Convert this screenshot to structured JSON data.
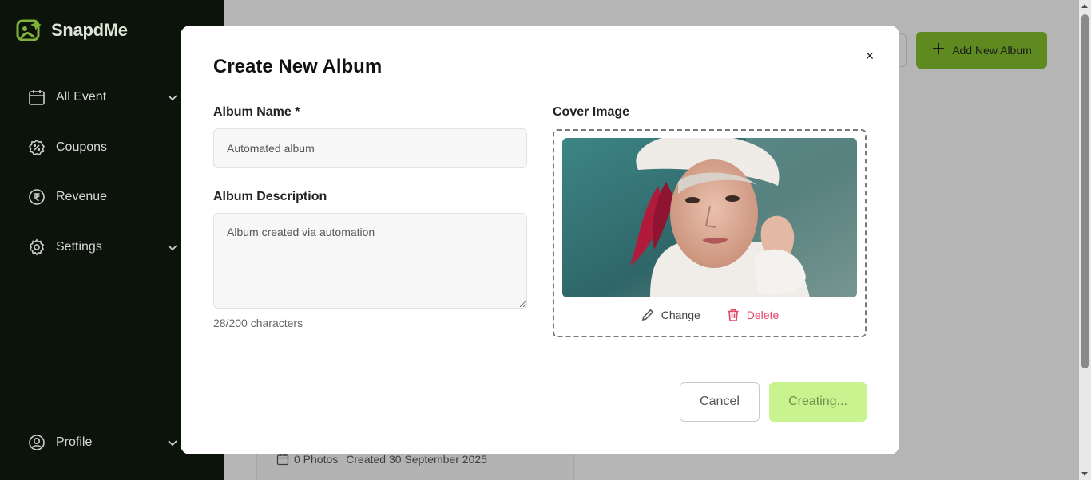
{
  "app": {
    "name": "SnapdMe"
  },
  "sidebar": {
    "items": [
      {
        "label": "All Event",
        "icon": "calendar-icon",
        "expandable": true
      },
      {
        "label": "Coupons",
        "icon": "coupon-icon",
        "expandable": false
      },
      {
        "label": "Revenue",
        "icon": "rupee-icon",
        "expandable": false
      },
      {
        "label": "Settings",
        "icon": "gear-icon",
        "expandable": true
      }
    ],
    "profile": {
      "label": "Profile",
      "icon": "user-circle-icon",
      "expandable": true
    }
  },
  "background": {
    "add_album_label": "Add New Album",
    "card": {
      "photos": "0 Photos",
      "created": "Created 30 September 2025"
    }
  },
  "modal": {
    "title": "Create New Album",
    "close_label": "×",
    "album_name": {
      "label": "Album Name *",
      "value": "Automated album"
    },
    "album_description": {
      "label": "Album Description",
      "value": "Album created via automation",
      "char_count": "28/200 characters"
    },
    "cover_image": {
      "label": "Cover Image",
      "change_label": "Change",
      "delete_label": "Delete"
    },
    "cancel_label": "Cancel",
    "submit_label": "Creating..."
  },
  "colors": {
    "sidebar_bg": "#0b130b",
    "accent_green": "#8bc53f",
    "submit_disabled_bg": "#c9f38f",
    "delete_red": "#e0466a"
  }
}
